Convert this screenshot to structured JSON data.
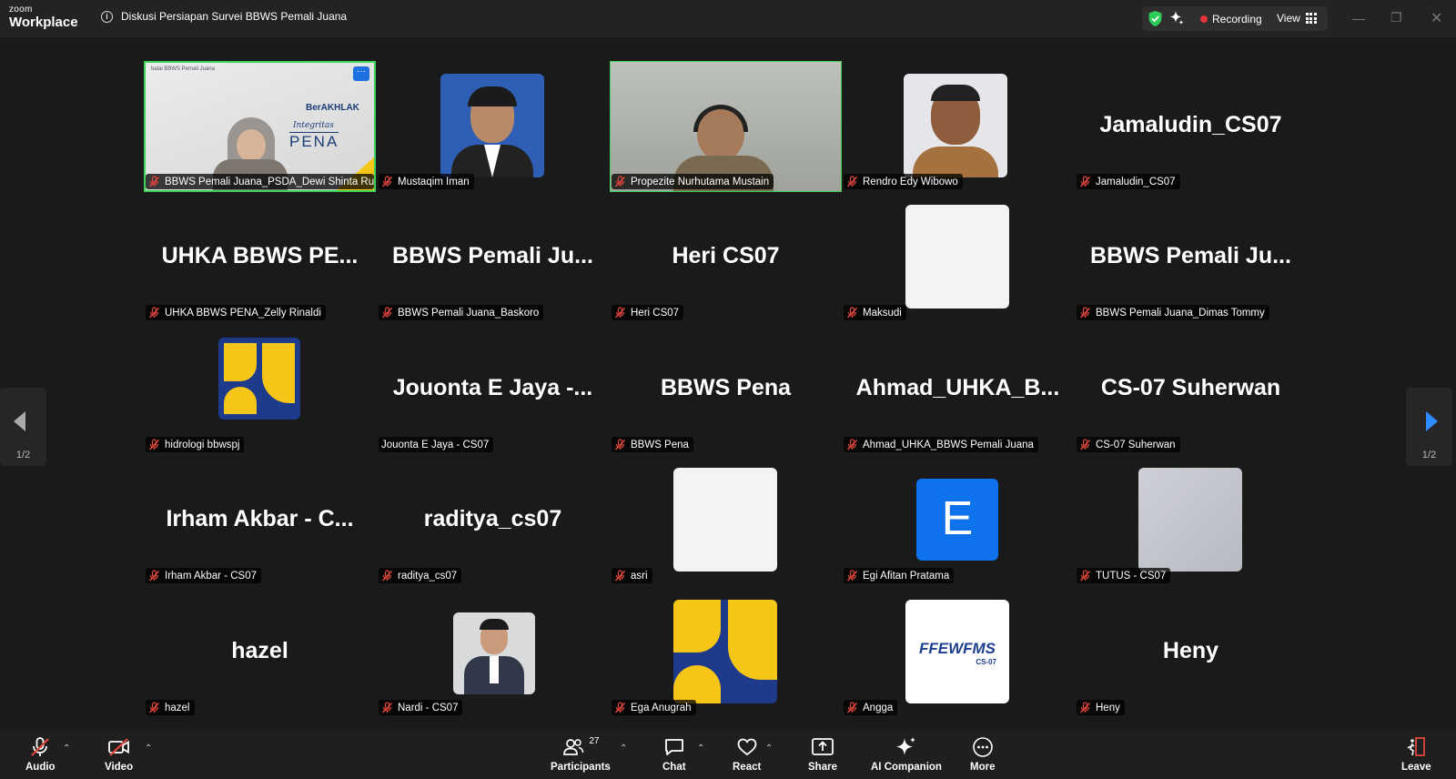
{
  "app": {
    "logo_top": "zoom",
    "logo_bottom": "Workplace"
  },
  "meeting": {
    "title": "Diskusi Persiapan Survei BBWS Pemali Juana"
  },
  "status": {
    "recording": "Recording",
    "view": "View"
  },
  "colors": {
    "accent": "#0b5cff",
    "recording": "#e8323c",
    "muted": "#e0463c",
    "active_speaker": "#3fd25a"
  },
  "tiles": [
    {
      "name": "BBWS Pemali Juana_PSDA_Dewi Shinta Rullsy...",
      "big": "",
      "kind": "video-presenter"
    },
    {
      "name": "Mustaqim Iman",
      "big": "",
      "kind": "photo-man"
    },
    {
      "name": "Propezite Nurhutama Mustain",
      "big": "",
      "kind": "video-headset"
    },
    {
      "name": "Rendro Edy Wibowo",
      "big": "",
      "kind": "photo-man2"
    },
    {
      "name": "Jamaludin_CS07",
      "big": "Jamaludin_CS07",
      "kind": "name"
    },
    {
      "name": "UHKA BBWS PENA_Zelly Rinaldi",
      "big": "UHKA BBWS PE...",
      "kind": "name"
    },
    {
      "name": "BBWS Pemali Juana_Baskoro",
      "big": "BBWS Pemali Ju...",
      "kind": "name"
    },
    {
      "name": "Heri CS07",
      "big": "Heri CS07",
      "kind": "name"
    },
    {
      "name": "Maksudi",
      "big": "",
      "kind": "blank"
    },
    {
      "name": "BBWS Pemali Juana_Dimas Tommy",
      "big": "BBWS Pemali Ju...",
      "kind": "name"
    },
    {
      "name": "hidrologi bbwspj",
      "big": "",
      "kind": "pu-small"
    },
    {
      "name": "Jouonta E Jaya - CS07",
      "big": "Jouonta E Jaya -...",
      "kind": "name-unmuted"
    },
    {
      "name": "BBWS Pena",
      "big": "BBWS Pena",
      "kind": "name"
    },
    {
      "name": "Ahmad_UHKA_BBWS Pemali Juana",
      "big": "Ahmad_UHKA_B...",
      "kind": "name"
    },
    {
      "name": "CS-07 Suherwan",
      "big": "CS-07 Suherwan",
      "kind": "name"
    },
    {
      "name": "Irham Akbar - CS07",
      "big": "Irham Akbar - C...",
      "kind": "name"
    },
    {
      "name": "raditya_cs07",
      "big": "raditya_cs07",
      "kind": "name"
    },
    {
      "name": "asri",
      "big": "",
      "kind": "blank"
    },
    {
      "name": "Egi Afitan Pratama",
      "big": "E",
      "kind": "letter"
    },
    {
      "name": "TUTUS - CS07",
      "big": "",
      "kind": "grey"
    },
    {
      "name": "hazel",
      "big": "hazel",
      "kind": "name"
    },
    {
      "name": "Nardi - CS07",
      "big": "",
      "kind": "photo-suit"
    },
    {
      "name": "Ega Anugrah",
      "big": "",
      "kind": "pu-large"
    },
    {
      "name": "Angga",
      "big": "",
      "kind": "ffews"
    },
    {
      "name": "Heny",
      "big": "Heny",
      "kind": "name"
    }
  ],
  "presenter_slide": {
    "brand": "BerAKHLAK",
    "title": "Integritas",
    "logo": "PENA",
    "header": "balai BBWS Pemali Juana"
  },
  "logo_text": {
    "ffews": "FFEWFMS",
    "ffews_sub": "CS-07"
  },
  "paging": {
    "left": "1/2",
    "right": "1/2"
  },
  "toolbar": {
    "audio": "Audio",
    "video": "Video",
    "participants": "Participants",
    "participants_count": "27",
    "chat": "Chat",
    "react": "React",
    "share": "Share",
    "ai": "AI Companion",
    "more": "More",
    "leave": "Leave"
  }
}
